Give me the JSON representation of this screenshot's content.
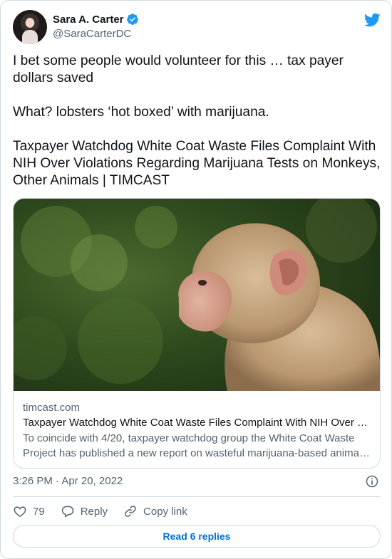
{
  "author": {
    "name": "Sara A. Carter",
    "handle": "@SaraCarterDC",
    "verified": true
  },
  "tweet": {
    "text": "I bet some people would volunteer for this … tax payer dollars saved\n\nWhat? lobsters ‘hot boxed’ with marijuana.\n\nTaxpayer Watchdog White Coat Waste Files Complaint With NIH Over Violations Regarding Marijuana Tests on Monkeys, Other Animals | TIMCAST"
  },
  "link_card": {
    "image_subject": "rhesus monkey in profile against green foliage",
    "domain": "timcast.com",
    "title": "Taxpayer Watchdog White Coat Waste Files Complaint With NIH Over Violations Regarding Marijuana Tests on Monkeys, Other Animals",
    "description_line1": "To coincide with 4/20, taxpayer watchdog group the White Coat Waste",
    "description_line2": "Project has published a new report on wasteful marijuana-based animal experiments"
  },
  "meta": {
    "timestamp": "3:26 PM · Apr 20, 2022"
  },
  "actions": {
    "like_count": "79",
    "reply_label": "Reply",
    "copy_label": "Copy link"
  },
  "replies_button": "Read 6 replies",
  "colors": {
    "twitter_blue": "#1d9bf0",
    "link_blue": "#006fd6",
    "secondary_text": "#536471",
    "border": "#cfd9de"
  }
}
